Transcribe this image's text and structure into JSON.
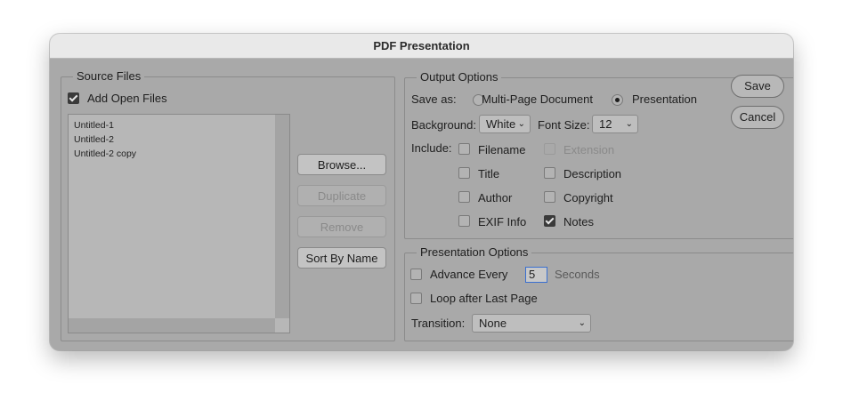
{
  "dialog": {
    "title": "PDF Presentation"
  },
  "source_files": {
    "title": "Source Files",
    "add_open_files": {
      "label": "Add Open Files",
      "checked": true
    },
    "files": [
      "Untitled-1",
      "Untitled-2",
      "Untitled-2 copy"
    ],
    "buttons": {
      "browse": "Browse...",
      "duplicate": "Duplicate",
      "remove": "Remove",
      "sort": "Sort By Name"
    }
  },
  "output_options": {
    "title": "Output Options",
    "save_as_label": "Save as:",
    "save_as_options": [
      {
        "label": "Multi-Page Document",
        "selected": false
      },
      {
        "label": "Presentation",
        "selected": true
      }
    ],
    "background_label": "Background:",
    "background_value": "White",
    "font_size_label": "Font Size:",
    "font_size_value": "12",
    "include_label": "Include:",
    "include": {
      "filename": {
        "label": "Filename",
        "checked": false
      },
      "extension": {
        "label": "Extension",
        "checked": false,
        "disabled": true
      },
      "title": {
        "label": "Title",
        "checked": false
      },
      "description": {
        "label": "Description",
        "checked": false
      },
      "author": {
        "label": "Author",
        "checked": false
      },
      "copyright": {
        "label": "Copyright",
        "checked": false
      },
      "exif": {
        "label": "EXIF Info",
        "checked": false
      },
      "notes": {
        "label": "Notes",
        "checked": true
      }
    }
  },
  "presentation_options": {
    "title": "Presentation Options",
    "advance_every": {
      "label": "Advance Every",
      "checked": false,
      "value": "5",
      "unit": "Seconds"
    },
    "loop": {
      "label": "Loop after Last Page",
      "checked": false
    },
    "transition_label": "Transition:",
    "transition_value": "None"
  },
  "actions": {
    "save": "Save",
    "cancel": "Cancel"
  },
  "icons": {
    "dropdown": "chevron-down-icon",
    "checkmark": "checkmark-icon"
  }
}
